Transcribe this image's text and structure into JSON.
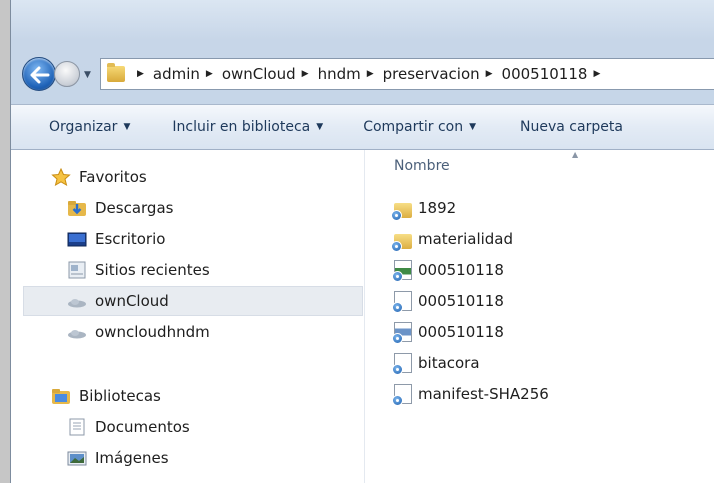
{
  "address_bar": {
    "crumbs": [
      "admin",
      "ownCloud",
      "hndm",
      "preservacion",
      "000510118"
    ]
  },
  "toolbar": {
    "organize": "Organizar",
    "include_library": "Incluir en biblioteca",
    "share_with": "Compartir con",
    "new_folder": "Nueva carpeta"
  },
  "nav_pane": {
    "favorites_header": "Favoritos",
    "favorites": [
      {
        "label": "Descargas",
        "icon": "downloads-icon"
      },
      {
        "label": "Escritorio",
        "icon": "desktop-icon"
      },
      {
        "label": "Sitios recientes",
        "icon": "recent-places-icon"
      },
      {
        "label": "ownCloud",
        "icon": "cloud-icon",
        "selected": true
      },
      {
        "label": "owncloudhndm",
        "icon": "cloud-icon"
      }
    ],
    "libraries_header": "Bibliotecas",
    "libraries": [
      {
        "label": "Documentos",
        "icon": "documents-icon"
      },
      {
        "label": "Imágenes",
        "icon": "pictures-icon"
      }
    ]
  },
  "file_list": {
    "column_name": "Nombre",
    "items": [
      {
        "name": "1892",
        "type": "folder"
      },
      {
        "name": "materialidad",
        "type": "folder"
      },
      {
        "name": "000510118",
        "type": "file"
      },
      {
        "name": "000510118",
        "type": "file"
      },
      {
        "name": "000510118",
        "type": "file"
      },
      {
        "name": "bitacora",
        "type": "file"
      },
      {
        "name": "manifest-SHA256",
        "type": "file"
      }
    ]
  },
  "colors": {
    "accent": "#1e395b",
    "selection": "#e8ecf1",
    "owncloud_badge": "#1d5fad"
  }
}
